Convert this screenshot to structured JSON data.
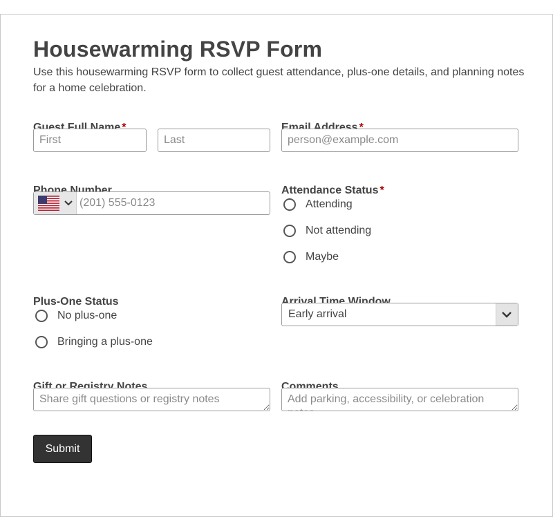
{
  "form": {
    "title": "Housewarming RSVP Form",
    "description": "Use this housewarming RSVP form to collect guest attendance, plus-one details, and planning notes for a home celebration.",
    "required_marker": "*",
    "required_color": "#b00000",
    "submit_label": "Submit"
  },
  "guest_name": {
    "label": "Guest Full Name",
    "first_placeholder": "First",
    "last_placeholder": "Last",
    "first_value": "",
    "last_value": ""
  },
  "email": {
    "label": "Email Address",
    "placeholder": "person@example.com",
    "value": ""
  },
  "phone": {
    "label": "Phone Number",
    "country_flag": "us-flag-icon",
    "placeholder": "(201) 555-0123",
    "value": ""
  },
  "attendance": {
    "label": "Attendance Status",
    "options": [
      "Attending",
      "Not attending",
      "Maybe"
    ]
  },
  "plus_one": {
    "label": "Plus-One Status",
    "options": [
      "No plus-one",
      "Bringing a plus-one"
    ]
  },
  "arrival": {
    "label": "Arrival Time Window",
    "selected": "Early arrival"
  },
  "gift_notes": {
    "label": "Gift or Registry Notes",
    "placeholder": "Share gift questions or registry notes",
    "value": ""
  },
  "comments": {
    "label": "Comments",
    "placeholder": "Add parking, accessibility, or celebration notes",
    "value": ""
  }
}
